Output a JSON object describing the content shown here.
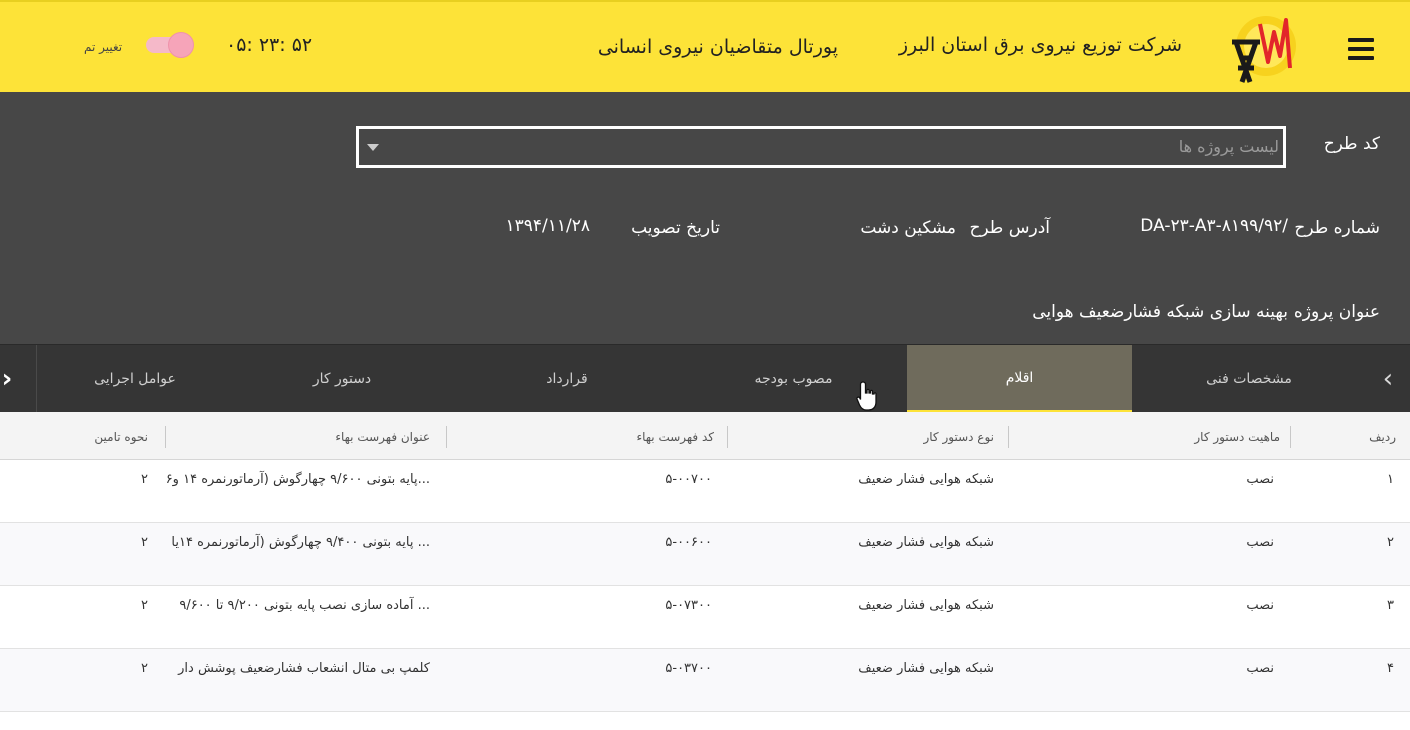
{
  "header": {
    "brand_text": "شرکت توزیع نیروی برق استان البرز",
    "portal_text": "پورتال متقاضیان نیروی انسانی",
    "clock": "۰۵: ۲۳: ۵۲",
    "theme_toggle_label": "تغییر تم",
    "colors": {
      "header_bg": "#fde338",
      "toggle": "#f6a4b9"
    }
  },
  "project": {
    "code_label": "کد طرح",
    "code_placeholder": "لیست پروژه ها",
    "number_label": "شماره طرح",
    "number_value": "DA-۲۳-A۳-۸۱۹۹/۹۲/",
    "address_label": "آدرس طرح",
    "address_value": "مشکین دشت",
    "approval_date_label": "تاریخ تصویب",
    "approval_date_value": "۱۳۹۴/۱۱/۲۸",
    "title_label": "عنوان پروژه",
    "title_value": "بهینه سازی شبکه فشارضعیف هوایی"
  },
  "tabs": [
    {
      "label": "مشخصات فنی"
    },
    {
      "label": "اقلام"
    },
    {
      "label": "مصوب بودجه"
    },
    {
      "label": "قرارداد"
    },
    {
      "label": "دستور کار"
    },
    {
      "label": "عوامل اجرایی"
    }
  ],
  "active_tab": "اقلام",
  "table": {
    "columns": [
      "ردیف",
      "ماهیت دستور کار",
      "نوع دستور کار",
      "کد فهرست بهاء",
      "عنوان فهرست بهاء",
      "نحوه تامین"
    ],
    "rows": [
      {
        "index": "۱",
        "nature": "نصب",
        "type": "شبکه هوایی فشار ضعیف",
        "code": "۵-۰۰۷۰۰",
        "title": "پایه بتونی ۹/۶۰۰ چهارگوش (آرماتورنمره ۱۴ و۶...",
        "supply": "۲"
      },
      {
        "index": "۲",
        "nature": "نصب",
        "type": "شبکه هوایی فشار ضعیف",
        "code": "۵-۰۰۶۰۰",
        "title": "پایه بتونی ۹/۴۰۰ چهارگوش (آرماتورنمره ۱۴یا ...",
        "supply": "۲"
      },
      {
        "index": "۳",
        "nature": "نصب",
        "type": "شبکه هوایی فشار ضعیف",
        "code": "۵-۰۷۳۰۰",
        "title": "آماده سازی نصب پایه بتونی ۹/۲۰۰ تا ۹/۶۰۰ ...",
        "supply": "۲"
      },
      {
        "index": "۴",
        "nature": "نصب",
        "type": "شبکه هوایی فشار ضعیف",
        "code": "۵-۰۳۷۰۰",
        "title": "کلمپ بی متال انشعاب فشارضعیف پوشش دار",
        "supply": "۲"
      }
    ]
  },
  "icons": {
    "menu": "hamburger-icon",
    "logo": "power-company-logo",
    "prev": "chevron-left-icon",
    "next": "chevron-right-icon",
    "dropdown": "caret-down-icon"
  }
}
